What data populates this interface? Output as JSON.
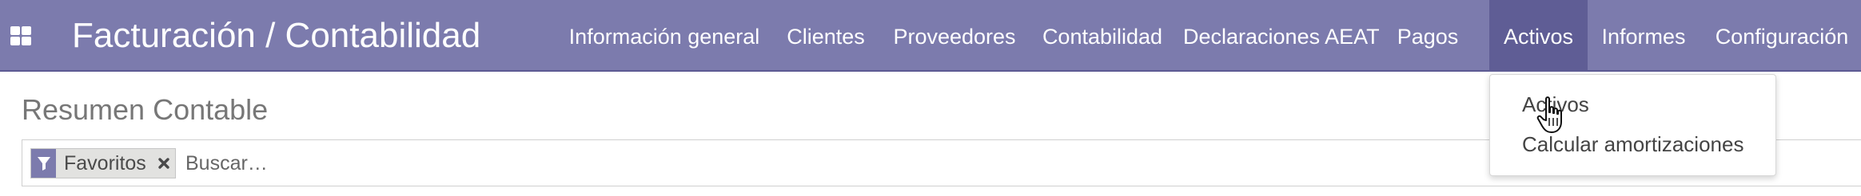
{
  "app": {
    "title": "Facturación / Contabilidad",
    "menu": [
      {
        "label": "Información general"
      },
      {
        "label": "Clientes"
      },
      {
        "label": "Proveedores"
      },
      {
        "label": "Contabilidad"
      },
      {
        "label": "Declaraciones AEAT"
      },
      {
        "label": "Pagos"
      },
      {
        "label": "Activos",
        "active": true
      },
      {
        "label": "Informes"
      },
      {
        "label": "Configuración"
      }
    ]
  },
  "page": {
    "title": "Resumen Contable"
  },
  "search": {
    "facet_label": "Favoritos",
    "facet_icon": "filter-icon",
    "placeholder": "Buscar…"
  },
  "dropdown": {
    "items": [
      {
        "label": "Activos"
      },
      {
        "label": "Calcular amortizaciones"
      }
    ]
  },
  "colors": {
    "navbar": "#7c7bad",
    "active_menu": "#5f5d95",
    "text_light": "#ffffff"
  }
}
